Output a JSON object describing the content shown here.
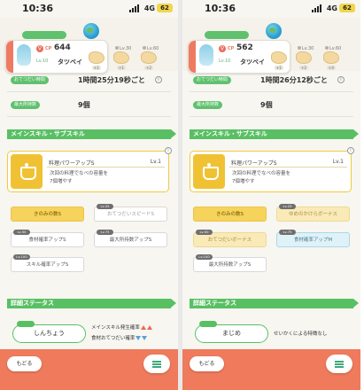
{
  "phones": [
    {
      "time": "10:36",
      "network": "4G",
      "battery": "62",
      "tag_label": "",
      "pokemon": {
        "cp_label": "CP",
        "cp": "644",
        "level": "Lv.10",
        "name": "タツベイ"
      },
      "ingredients": [
        {
          "level": "Lv.30",
          "count": "+1"
        },
        {
          "level": "Lv.60",
          "count": "+2"
        }
      ],
      "first_count": "+1",
      "stats": [
        {
          "label": "おてつだい時間",
          "value": "1時間25分19秒ごと"
        },
        {
          "label": "最大所持数",
          "value": "9個"
        }
      ],
      "section_skills": "メインスキル・サブスキル",
      "main_skill": {
        "name": "料理パワーアップS",
        "level": "Lv.1",
        "desc": "次回の料理でなべの容量を\n7個増やす"
      },
      "subskills": [
        {
          "tag": "",
          "label": "きのみの数S",
          "style": "gold"
        },
        {
          "tag": "Lv.25",
          "label": "おてつだいスピードS",
          "style": "white"
        },
        {
          "tag": "Lv.50",
          "label": "食材確率アップS",
          "style": "white on"
        },
        {
          "tag": "Lv.75",
          "label": "最大所持数アップS",
          "style": "white on"
        },
        {
          "tag": "Lv.100",
          "label": "スキル確率アップS",
          "style": "white on"
        }
      ],
      "section_details": "詳細ステータス",
      "nature_tag": "",
      "nature": "しんちょう",
      "effects": [
        {
          "text": "メインスキル発生確率",
          "arrows": [
            "up",
            "up"
          ]
        },
        {
          "text": "食材おてつだい確率",
          "arrows": [
            "down",
            "down"
          ]
        }
      ],
      "back_label": "もどる"
    },
    {
      "time": "10:36",
      "network": "4G",
      "battery": "62",
      "tag_label": "",
      "pokemon": {
        "cp_label": "CP",
        "cp": "562",
        "level": "Lv.10",
        "name": "タツベイ"
      },
      "ingredients": [
        {
          "level": "Lv.30",
          "count": "+2"
        },
        {
          "level": "Lv.60",
          "count": "+4"
        }
      ],
      "first_count": "+1",
      "stats": [
        {
          "label": "おてつだい時間",
          "value": "1時間26分12秒ごと"
        },
        {
          "label": "最大所持数",
          "value": "9個"
        }
      ],
      "section_skills": "メインスキル・サブスキル",
      "main_skill": {
        "name": "料理パワーアップS",
        "level": "Lv.1",
        "desc": "次回の料理でなべの容量を\n7個増やす"
      },
      "subskills": [
        {
          "tag": "",
          "label": "きのみの数S",
          "style": "gold"
        },
        {
          "tag": "Lv.25",
          "label": "ゆめのかけらボーナス",
          "style": "cream"
        },
        {
          "tag": "Lv.50",
          "label": "おてつだいボーナス",
          "style": "cream"
        },
        {
          "tag": "Lv.75",
          "label": "食材確率アップM",
          "style": "blue"
        },
        {
          "tag": "Lv.100",
          "label": "最大所持数アップS",
          "style": "white on"
        }
      ],
      "section_details": "詳細ステータス",
      "nature_tag": "",
      "nature": "まじめ",
      "effects": [
        {
          "text": "せいかくによる特徴なし",
          "arrows": []
        }
      ],
      "back_label": "もどる"
    }
  ],
  "colors": {
    "green": "#58c063",
    "orange": "#ef7a5c",
    "gold": "#f0c233"
  },
  "icons": [
    "globe-icon",
    "gender-icon",
    "info-icon",
    "pot-icon",
    "menu-icon",
    "ingredient-icon"
  ]
}
